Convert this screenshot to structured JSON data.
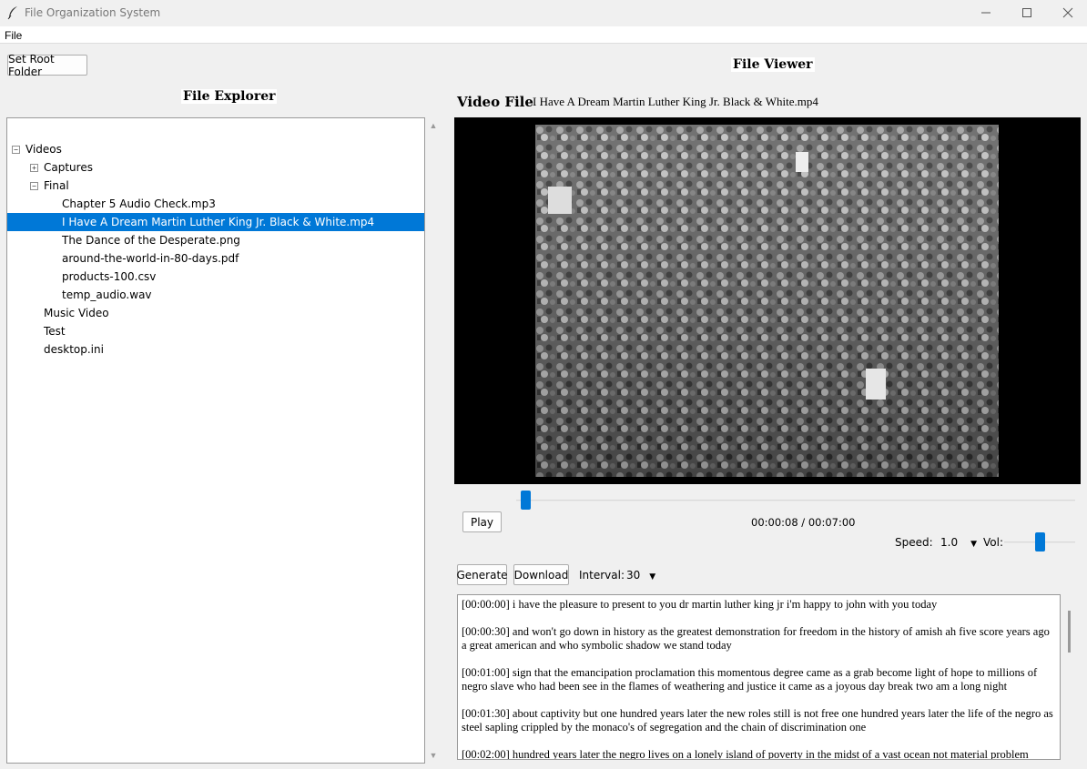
{
  "window": {
    "title": "File Organization System",
    "icon": "feather-icon"
  },
  "menubar": {
    "file_label": "File"
  },
  "left": {
    "set_root_label": "Set Root Folder",
    "heading": "File Explorer",
    "tree": [
      {
        "label": "Videos",
        "expander": "⊟",
        "indent": 0
      },
      {
        "label": "Captures",
        "expander": "⊞",
        "indent": 1
      },
      {
        "label": "Final",
        "expander": "⊟",
        "indent": 1
      },
      {
        "label": "Chapter 5 Audio Check.mp3",
        "indent": 2
      },
      {
        "label": "I Have A Dream Martin Luther King Jr. Black & White.mp4",
        "indent": 2,
        "selected": true
      },
      {
        "label": "The Dance of the Desperate.png",
        "indent": 2
      },
      {
        "label": "around-the-world-in-80-days.pdf",
        "indent": 2
      },
      {
        "label": "products-100.csv",
        "indent": 2
      },
      {
        "label": "temp_audio.wav",
        "indent": 2
      },
      {
        "label": "Music Video",
        "indent": 1
      },
      {
        "label": "Test",
        "indent": 1
      },
      {
        "label": "desktop.ini",
        "indent": 1
      }
    ]
  },
  "viewer": {
    "heading": "File Viewer",
    "file_type_label": "Video File",
    "file_name": "I Have A Dream Martin Luther King Jr. Black & White.mp4",
    "play_label": "Play",
    "time_display": "00:00:08 / 00:07:00",
    "progress": 0.016,
    "speed_label": "Speed:",
    "speed_value": "1.0",
    "vol_label": "Vol:",
    "volume": 0.5,
    "generate_label": "Generate",
    "download_label": "Download",
    "interval_label": "Interval:",
    "interval_value": "30",
    "transcript": [
      "[00:00:00] i have the pleasure to present to you dr martin luther king jr i'm happy to john with you today",
      "[00:00:30] and won't go down in history as the greatest demonstration for freedom in the history of amish ah five score years ago a great american and who symbolic shadow we stand today",
      "[00:01:00] sign that the emancipation proclamation this momentous degree came as a grab become light of hope to millions of negro slave who had been see in the flames of weathering and justice it came as a joyous day break two am a long night",
      "[00:01:30] about captivity but one hundred years later the new roles still is not free one hundred years later the life of the negro as steel sapling crippled by the monaco's of segregation and the chain of discrimination one",
      "[00:02:00] hundred years later the negro lives on a lonely island of poverty in the midst of a vast ocean not material problem"
    ]
  },
  "colors": {
    "accent": "#0078d7",
    "selected_bg": "#0078d7",
    "video_bg": "#000000"
  }
}
